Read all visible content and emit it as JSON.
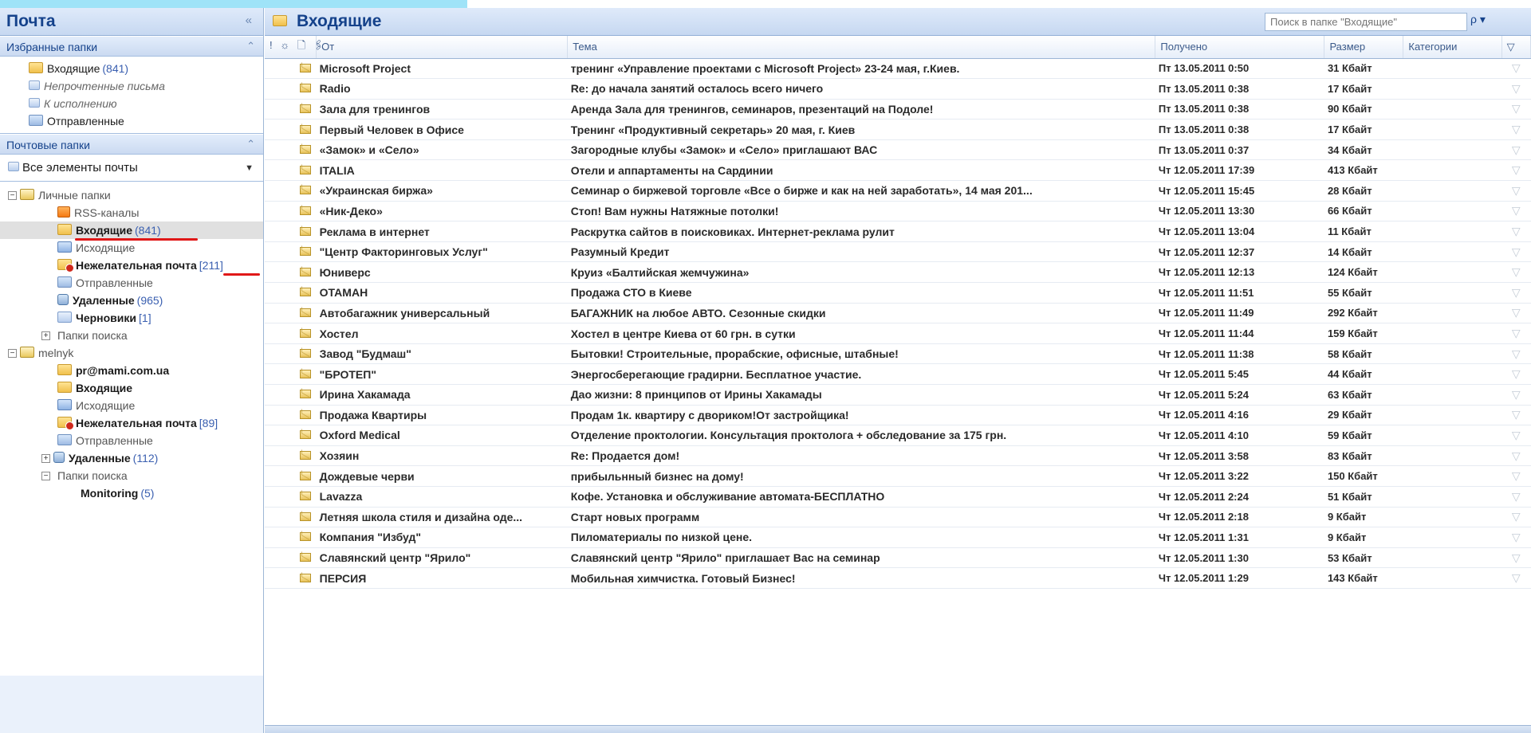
{
  "nav": {
    "title": "Почта",
    "collapse_glyph": "«",
    "favorites": {
      "title": "Избранные папки",
      "toggle": "⌃",
      "items": [
        {
          "label": "Входящие",
          "count": "(841)",
          "icon": "inbox-folder-icon",
          "italic": false
        },
        {
          "label": "Непрочтенные письма",
          "count": "",
          "icon": "search-folder-icon",
          "italic": true
        },
        {
          "label": "К исполнению",
          "count": "",
          "icon": "search-folder-icon",
          "italic": true
        },
        {
          "label": "Отправленные",
          "count": "",
          "icon": "sent-folder-icon",
          "italic": false
        }
      ]
    },
    "mail_folders": {
      "title": "Почтовые папки",
      "toggle": "⌃",
      "all_items": "Все элементы почты",
      "tree": [
        {
          "label": "Личные папки",
          "count": "",
          "exp": "−",
          "icon": "pst",
          "level": 0,
          "bold": false
        },
        {
          "label": "RSS-каналы",
          "count": "",
          "icon": "rss",
          "level": 2,
          "bold": false
        },
        {
          "label": "Входящие",
          "count": "(841)",
          "icon": "folder",
          "level": 2,
          "bold": true,
          "selected": true
        },
        {
          "label": "Исходящие",
          "count": "",
          "icon": "outbox",
          "level": 2,
          "bold": false
        },
        {
          "label": "Нежелательная почта",
          "count": "[211]",
          "icon": "junk",
          "level": 2,
          "bold": true
        },
        {
          "label": "Отправленные",
          "count": "",
          "icon": "sent",
          "level": 2,
          "bold": false
        },
        {
          "label": "Удаленные",
          "count": "(965)",
          "icon": "trash",
          "level": 2,
          "bold": true
        },
        {
          "label": "Черновики",
          "count": "[1]",
          "icon": "draft",
          "level": 2,
          "bold": true
        },
        {
          "label": "Папки поиска",
          "count": "",
          "exp": "+",
          "icon": "search",
          "level": 1,
          "bold": false
        },
        {
          "label": "melnyk",
          "count": "",
          "exp": "−",
          "icon": "pst",
          "level": 0,
          "bold": false
        },
        {
          "label": "pr@mami.com.ua",
          "count": "",
          "icon": "folder",
          "level": 2,
          "bold": true
        },
        {
          "label": "Входящие",
          "count": "",
          "icon": "folder",
          "level": 2,
          "bold": true
        },
        {
          "label": "Исходящие",
          "count": "",
          "icon": "outbox",
          "level": 2,
          "bold": false
        },
        {
          "label": "Нежелательная почта",
          "count": "[89]",
          "icon": "junk",
          "level": 2,
          "bold": true
        },
        {
          "label": "Отправленные",
          "count": "",
          "icon": "sent",
          "level": 2,
          "bold": false
        },
        {
          "label": "Удаленные",
          "count": "(112)",
          "exp": "+",
          "icon": "trash",
          "level": 1,
          "bold": true
        },
        {
          "label": "Папки поиска",
          "count": "",
          "exp": "−",
          "icon": "search",
          "level": 1,
          "bold": false
        },
        {
          "label": "Monitoring",
          "count": "(5)",
          "icon": "search",
          "level": 3,
          "bold": true
        }
      ]
    }
  },
  "main": {
    "title": "Входящие",
    "search_placeholder": "Поиск в папке \"Входящие\"",
    "search_button": "ρ ▾",
    "columns": {
      "flags": "! ☼ 🗋 🖇",
      "from": "От",
      "subject": "Тема",
      "received": "Получено",
      "size": "Размер",
      "categories": "Категории",
      "flag": "▽"
    },
    "emails": [
      {
        "from": "Microsoft Project",
        "subject": "тренинг «Управление проектами с Microsoft Project» 23-24 мая, г.Киев.",
        "received": "Пт 13.05.2011 0:50",
        "size": "31 Кбайт"
      },
      {
        "from": "Radio",
        "subject": "Re: до начала занятий осталось всего ничего",
        "received": "Пт 13.05.2011 0:38",
        "size": "17 Кбайт"
      },
      {
        "from": "Зала для тренингов",
        "subject": "Аренда Зала для тренингов, семинаров, презентаций на Подоле!",
        "received": "Пт 13.05.2011 0:38",
        "size": "90 Кбайт"
      },
      {
        "from": "Первый Человек в Офисе",
        "subject": "Тренинг «Продуктивный секретарь» 20 мая, г. Киев",
        "received": "Пт 13.05.2011 0:38",
        "size": "17 Кбайт"
      },
      {
        "from": "«Замок» и «Село»",
        "subject": "Загородные клубы «Замок» и «Село» приглашают ВАС",
        "received": "Пт 13.05.2011 0:37",
        "size": "34 Кбайт"
      },
      {
        "from": "ITALIA",
        "subject": "Отели и аппартаменты на Сардинии",
        "received": "Чт 12.05.2011 17:39",
        "size": "413 Кбайт"
      },
      {
        "from": "«Украинская биржа»",
        "subject": "Семинар о биржевой торговле «Все о бирже и как на ней заработать», 14 мая 201...",
        "received": "Чт 12.05.2011 15:45",
        "size": "28 Кбайт"
      },
      {
        "from": "«Ник-Деко»",
        "subject": "Стоп! Вам нужны Натяжные потолки!",
        "received": "Чт 12.05.2011 13:30",
        "size": "66 Кбайт"
      },
      {
        "from": "Реклама в интернет",
        "subject": "Раскрутка сайтов в поисковиках. Интернет-реклама рулит",
        "received": "Чт 12.05.2011 13:04",
        "size": "11 Кбайт"
      },
      {
        "from": "\"Центр Факторинговых Услуг\"",
        "subject": "Разумный Кредит",
        "received": "Чт 12.05.2011 12:37",
        "size": "14 Кбайт"
      },
      {
        "from": "Юниверс",
        "subject": "Круиз «Балтийская жемчужина»",
        "received": "Чт 12.05.2011 12:13",
        "size": "124 Кбайт"
      },
      {
        "from": "ОТАМАН",
        "subject": "Продажа СТО в Киеве",
        "received": "Чт 12.05.2011 11:51",
        "size": "55 Кбайт"
      },
      {
        "from": "Автобагажник универсальный",
        "subject": "БАГАЖНИК на любое АВТО. Сезонные скидки",
        "received": "Чт 12.05.2011 11:49",
        "size": "292 Кбайт"
      },
      {
        "from": "Хостел",
        "subject": "Хостел в центре Киева от 60 грн. в сутки",
        "received": "Чт 12.05.2011 11:44",
        "size": "159 Кбайт"
      },
      {
        "from": "Завод \"Будмаш\"",
        "subject": "Бытовки! Строительные, прорабские, офисные, штабные!",
        "received": "Чт 12.05.2011 11:38",
        "size": "58 Кбайт"
      },
      {
        "from": "\"БРОТЕП\"",
        "subject": "Энергосберегающие градирни. Бесплатное участие.",
        "received": "Чт 12.05.2011 5:45",
        "size": "44 Кбайт"
      },
      {
        "from": "Ирина Хакамада",
        "subject": "Дао жизни: 8 принципов от Ирины Хакамады",
        "received": "Чт 12.05.2011 5:24",
        "size": "63 Кбайт"
      },
      {
        "from": "Продажа Квартиры",
        "subject": "Продам 1к. квартиру с двориком!От застройщика!",
        "received": "Чт 12.05.2011 4:16",
        "size": "29 Кбайт"
      },
      {
        "from": "Oxford Medical",
        "subject": "Отделение проктологии. Консультация проктолога + обследование за 175 грн.",
        "received": "Чт 12.05.2011 4:10",
        "size": "59 Кбайт"
      },
      {
        "from": "Хозяин",
        "subject": "Re: Продается дом!",
        "received": "Чт 12.05.2011 3:58",
        "size": "83 Кбайт"
      },
      {
        "from": "Дождевые черви",
        "subject": "прибыльнный бизнес на дому!",
        "received": "Чт 12.05.2011 3:22",
        "size": "150 Кбайт"
      },
      {
        "from": "Lavazza",
        "subject": "Кофе. Установка и обслуживание автомата-БЕСПЛАТНО",
        "received": "Чт 12.05.2011 2:24",
        "size": "51 Кбайт"
      },
      {
        "from": "Летняя школа стиля и дизайна оде...",
        "subject": "Старт новых программ",
        "received": "Чт 12.05.2011 2:18",
        "size": "9 Кбайт"
      },
      {
        "from": "Компания \"Избуд\"",
        "subject": "Пиломатериалы по низкой цене.",
        "received": "Чт 12.05.2011 1:31",
        "size": "9 Кбайт"
      },
      {
        "from": "Славянский центр \"Ярило\"",
        "subject": "Славянский центр \"Ярило\" приглашает Вас на семинар",
        "received": "Чт 12.05.2011 1:30",
        "size": "53 Кбайт"
      },
      {
        "from": "ПЕРСИЯ",
        "subject": "Мобильная химчистка. Готовый Бизнес!",
        "received": "Чт 12.05.2011 1:29",
        "size": "143 Кбайт"
      }
    ]
  }
}
